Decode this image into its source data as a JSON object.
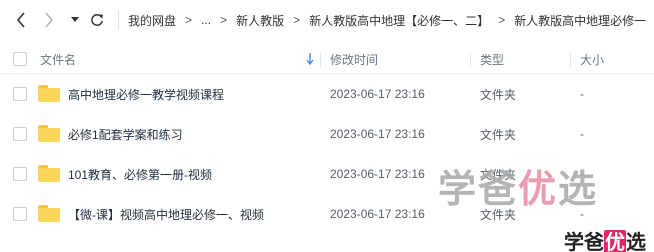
{
  "breadcrumb": [
    "我的网盘",
    "...",
    "新人教版",
    "新人教版高中地理【必修一、二】",
    "新人教版高中地理必修一"
  ],
  "breadcrumb_separator": ">",
  "header": {
    "name": "文件名",
    "mtime": "修改时间",
    "type": "类型",
    "size": "大小"
  },
  "rows": [
    {
      "name": "高中地理必修一教学视频课程",
      "mtime": "2023-06-17 23:16",
      "type": "文件夹",
      "size": "-"
    },
    {
      "name": "必修1配套学案和练习",
      "mtime": "2023-06-17 23:16",
      "type": "文件夹",
      "size": "-"
    },
    {
      "name": "101教育、必修第一册-视频",
      "mtime": "2023-06-17 23:16",
      "type": "文件夹",
      "size": "-"
    },
    {
      "name": "【微-课】视频高中地理必修一、视频",
      "mtime": "2023-06-17 23:16",
      "type": "文件夹",
      "size": "-"
    }
  ],
  "watermark_big": {
    "part1": "学爸",
    "part2": "优",
    "part3": "选"
  },
  "watermark_small": {
    "part1": "学爸",
    "part2": "优",
    "part3": "选"
  },
  "colors": {
    "accent": "#3b8cff",
    "folder": "#fcd55b",
    "watermark_pink": "#e0266a"
  },
  "icons": [
    "back-arrow-icon",
    "forward-arrow-icon",
    "dropdown-caret-icon",
    "refresh-icon",
    "sort-down-arrow-icon",
    "folder-icon"
  ]
}
